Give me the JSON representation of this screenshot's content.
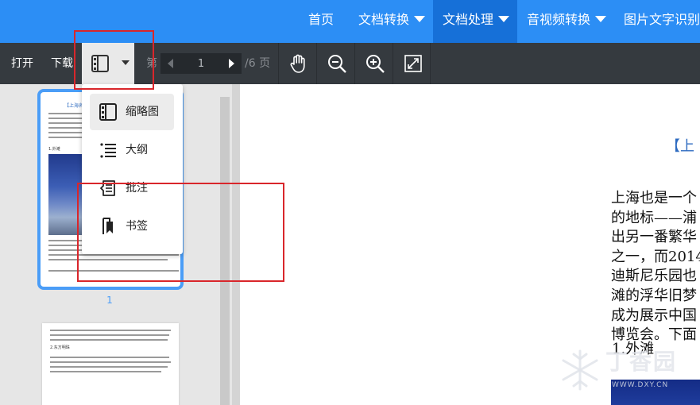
{
  "nav": {
    "items": [
      {
        "label": "首页",
        "has_menu": false,
        "active": false
      },
      {
        "label": "文档转换",
        "has_menu": true,
        "active": false
      },
      {
        "label": "文档处理",
        "has_menu": true,
        "active": true
      },
      {
        "label": "音视频转换",
        "has_menu": true,
        "active": false
      },
      {
        "label": "图片文字识别",
        "has_menu": false,
        "active": false
      }
    ]
  },
  "toolbar": {
    "open_label": "打开",
    "download_label": "下载",
    "page_prefix": "第",
    "page_value": "1",
    "page_total": "/6 页"
  },
  "menu": {
    "items": [
      {
        "label": "缩略图",
        "icon": "thumbnail-icon",
        "selected": true
      },
      {
        "label": "大纲",
        "icon": "outline-icon",
        "selected": false
      },
      {
        "label": "批注",
        "icon": "annotation-icon",
        "selected": false
      },
      {
        "label": "书签",
        "icon": "bookmark-icon",
        "selected": false
      }
    ]
  },
  "thumbnails": {
    "page1_title": "【上海名片】",
    "page1_heading": "1.外滩",
    "page1_number": "1",
    "page2_heading": "2.东方明珠"
  },
  "document": {
    "title": "【上",
    "lines": [
      "上海也是一个",
      "的地标——浦",
      "出另一番繁华",
      "之一，而2014",
      "迪斯尼乐园也",
      "滩的浮华旧梦",
      "成为展示中国",
      "博览会。下面"
    ],
    "heading": "1.外滩"
  },
  "watermark": {
    "cn": "丁香园",
    "en": "WWW.DXY.CN"
  },
  "colors": {
    "nav_bg": "#2c8ef5",
    "nav_active": "#1670d8",
    "toolbar_bg": "#353a3f",
    "accent": "#4a9df7",
    "annotation_red": "#d9262b"
  }
}
